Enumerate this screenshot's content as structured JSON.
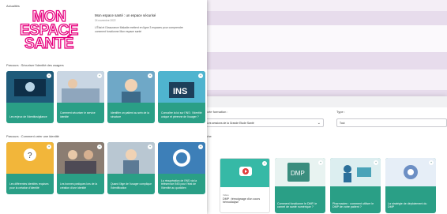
{
  "news": {
    "section_label": "Actualités",
    "logo_line1": "MON",
    "logo_line2": "ESPACE",
    "logo_line3": "SANTÉ",
    "title": "Mon espace santé : un espace sécurisé",
    "date": "24 novembre 2022",
    "body": "L'État et l'Assurance Maladie mettent en ligne 3 espaces pour comprendre comment fonctionne Mon espace santé"
  },
  "parcours1": {
    "label": "Parcours : Sécuriser l'identité des usagers",
    "cards": [
      {
        "title": "Les enjeux de l'identitovigilance"
      },
      {
        "title": "Comment sécuriser le service identité"
      },
      {
        "title": "Identifier un patient au sein de la structure"
      },
      {
        "title": "Connaître la loi sur l'INS : l'identité unique et pérenne de l'usager ?"
      }
    ]
  },
  "parcours2": {
    "label": "Parcours : Comment créer une identité",
    "cards": [
      {
        "title": "Les différentes identités requises pour la création d'identité"
      },
      {
        "title": "Les bonnes pratiques lors de la création d'une identité"
      },
      {
        "title": "Quand l'âge de l'usager complique l'identification"
      },
      {
        "title": "La récupération de l'INS via la téléservice INSi pour l'état de l'identité au quotidien"
      }
    ]
  },
  "filters": {
    "left_label": "Lycée formation :",
    "left_value": "Les sessions de la Grande Etude Santé",
    "right_label": "Type :",
    "right_value": "Tout",
    "section_label": "Fiche"
  },
  "back_cards": [
    {
      "title": "DMP : témoignage d'un cours hémodialyse",
      "tag": "Vidéo"
    },
    {
      "title": "Comment fonctionne le DMP, le carnet de santé numérique ?"
    },
    {
      "title": "Pharmacien : comment utiliser le DMP de votre patient ?"
    },
    {
      "title": "La stratégie de déploiement du DMP"
    }
  ],
  "icons": {
    "pin": "+"
  },
  "colors": {
    "brand_pink": "#e6007e",
    "card_teal": "#2a9f86",
    "panel_bg": "#e7dcec"
  }
}
